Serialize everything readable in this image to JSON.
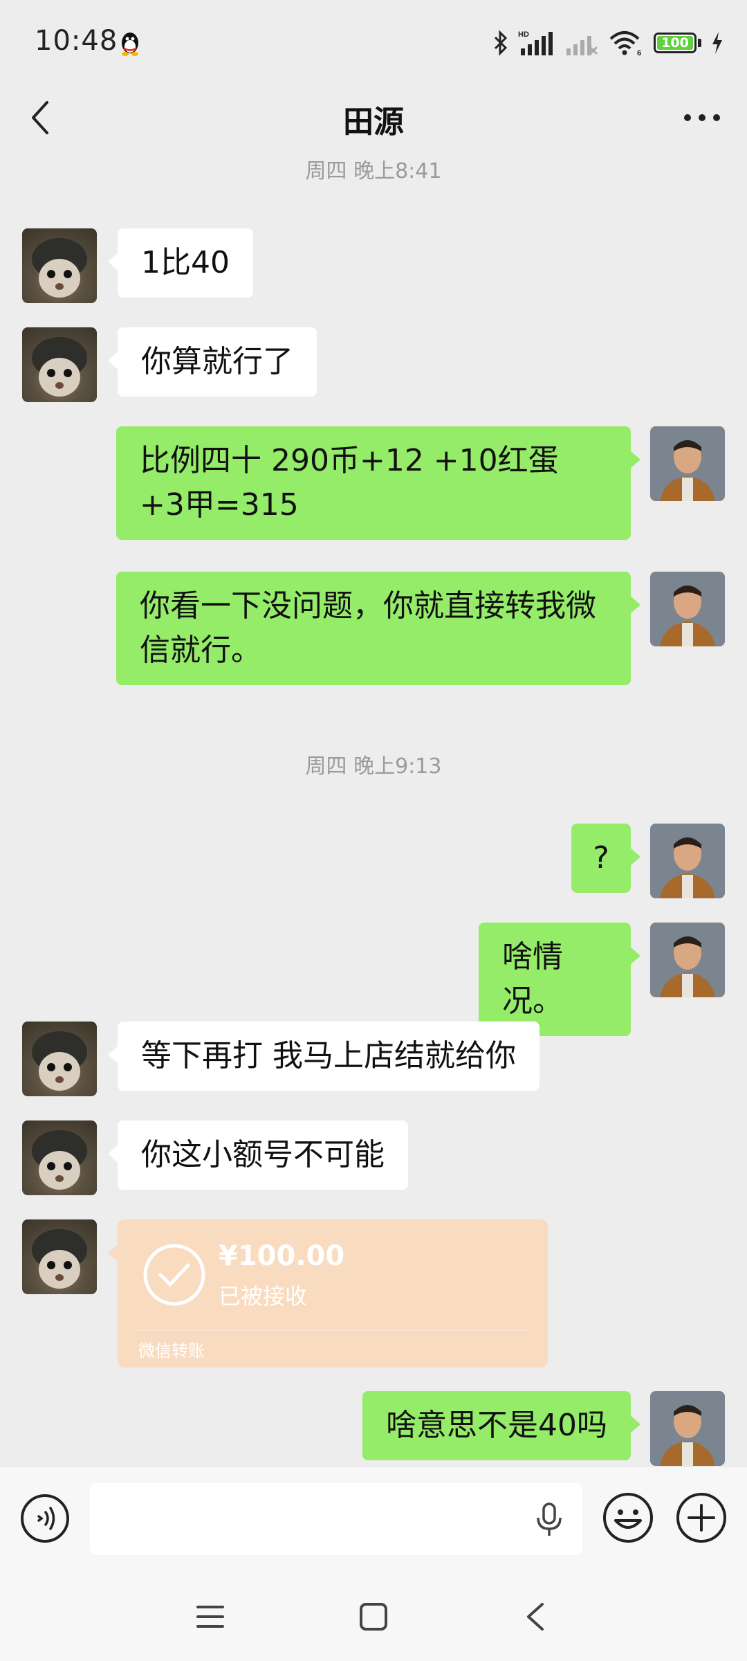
{
  "status_bar": {
    "time": "10:48",
    "network_label": "HD",
    "wifi_label": "6",
    "battery_level": 100,
    "battery_text": "100"
  },
  "header": {
    "title": "田源",
    "back_icon": "chevron-left-icon",
    "more_icon": "more-horizontal-icon"
  },
  "timestamps": [
    "周四 晚上8:41",
    "周四 晚上9:13"
  ],
  "messages": [
    {
      "from": "friend",
      "text": "1比40"
    },
    {
      "from": "friend",
      "text": "你算就行了"
    },
    {
      "from": "me",
      "text": "比例四十 290币+12 +10红蛋 +3甲=315"
    },
    {
      "from": "me",
      "text": "你看一下没问题，你就直接转我微信就行。"
    },
    {
      "from": "me",
      "text": "?"
    },
    {
      "from": "me",
      "text": "啥情况。"
    },
    {
      "from": "friend",
      "text": "等下再打 我马上店结就给你"
    },
    {
      "from": "friend",
      "text": "你这小额号不可能"
    },
    {
      "from": "me",
      "text": "啥意思不是40吗"
    }
  ],
  "transfer": {
    "amount": "¥100.00",
    "status": "已被接收",
    "label": "微信转账",
    "bg_color": "#f9dbbf"
  },
  "input_bar": {
    "placeholder": "",
    "voice_icon": "voice-toggle-icon",
    "mic_icon": "microphone-icon",
    "emoji_icon": "emoji-icon",
    "plus_icon": "plus-circle-icon"
  },
  "colors": {
    "background": "#ededed",
    "my_bubble": "#95ec69",
    "friend_bubble": "#ffffff",
    "timestamp": "#9a9a9a"
  }
}
